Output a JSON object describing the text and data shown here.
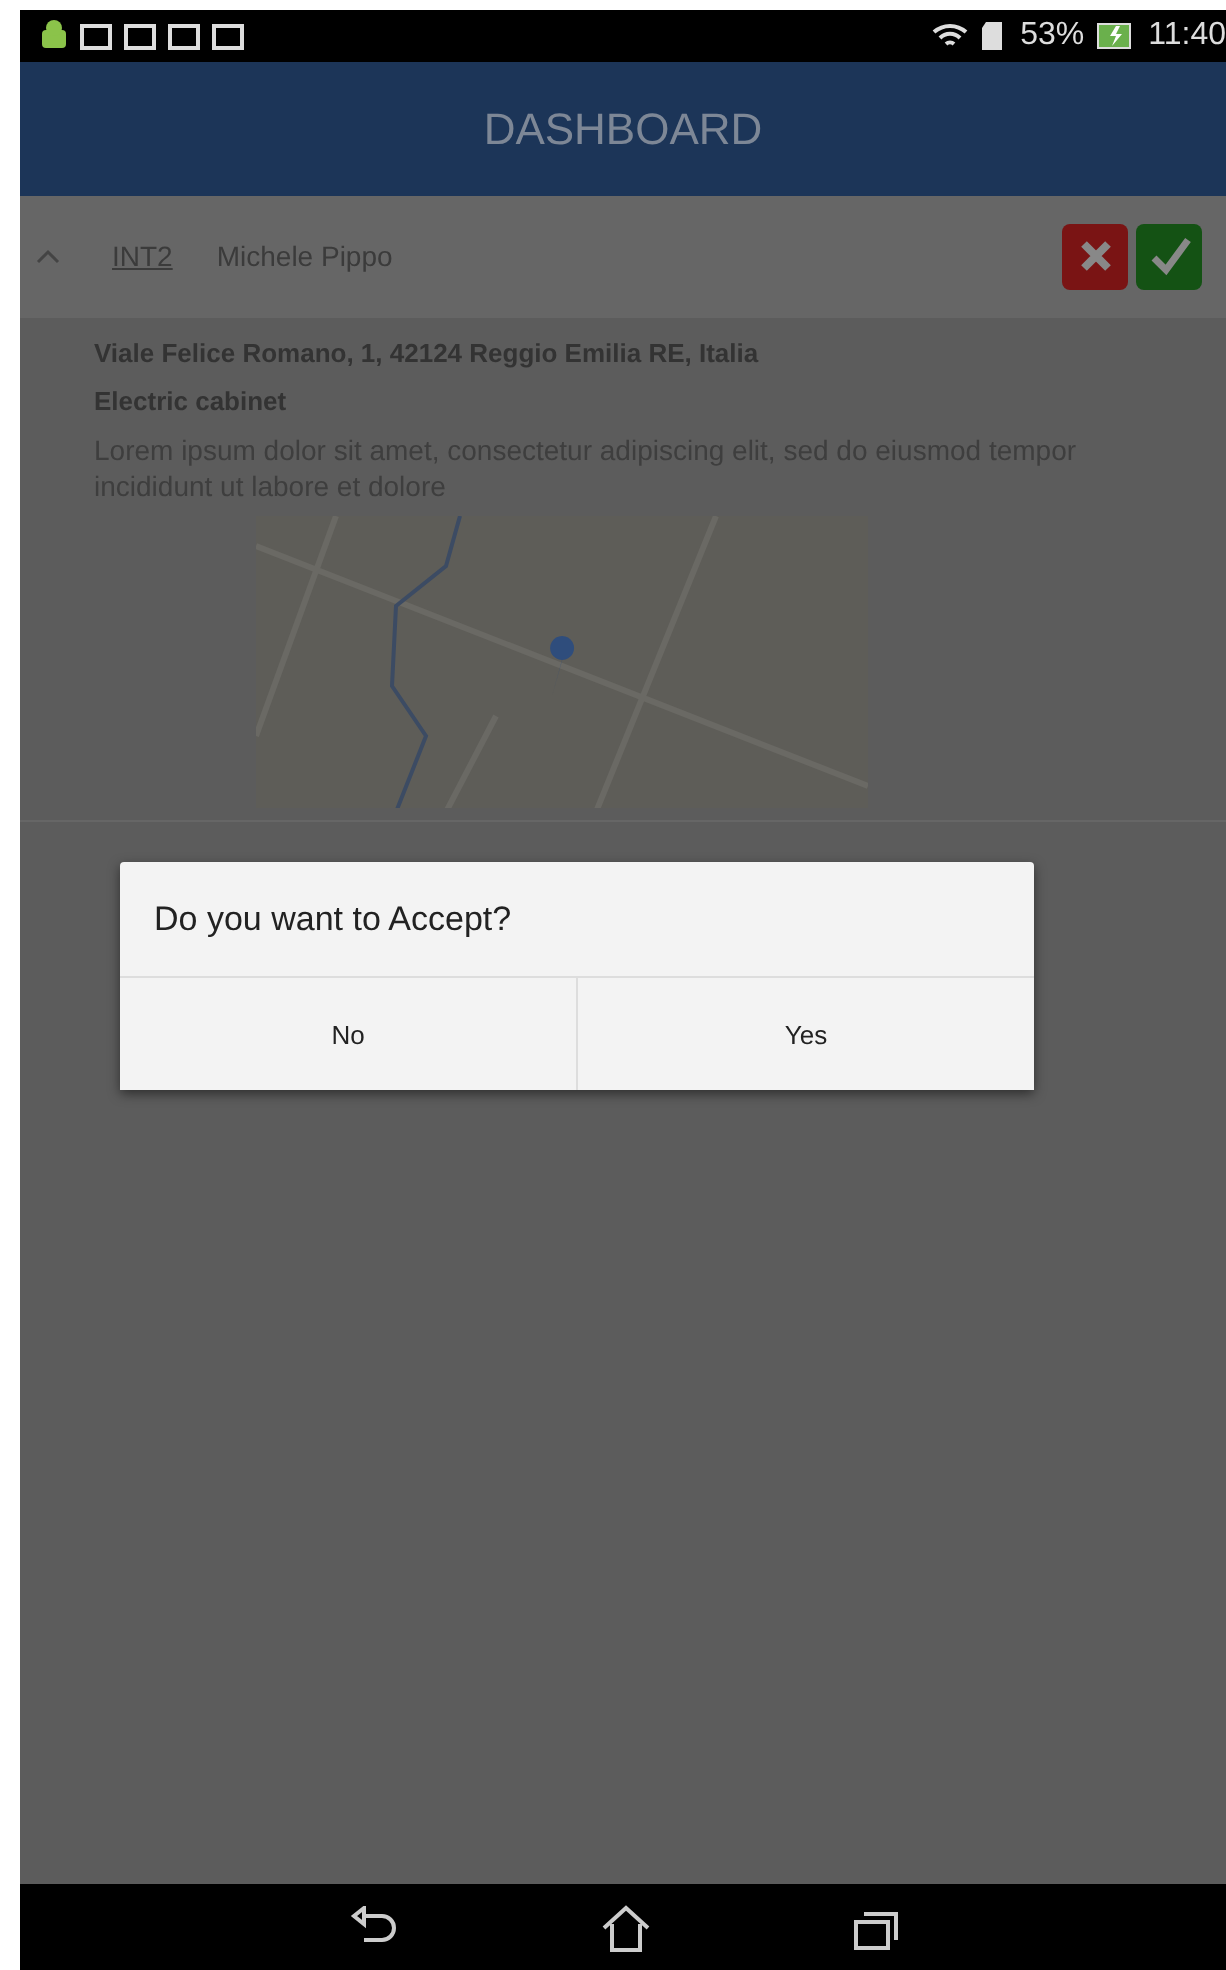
{
  "status_bar": {
    "battery": "53%",
    "time": "11:40"
  },
  "app_bar": {
    "title": "DASHBOARD"
  },
  "item": {
    "expanded": true,
    "code": "INT2",
    "name": "Michele Pippo",
    "address": "Viale Felice Romano, 1, 42124 Reggio Emilia RE, Italia",
    "category": "Electric cabinet",
    "description": "Lorem ipsum dolor sit amet, consectetur adipiscing elit, sed do eiusmod tempor incididunt ut labore et dolore"
  },
  "dialog": {
    "message": "Do you want to Accept?",
    "buttons": [
      {
        "label": "No"
      },
      {
        "label": "Yes"
      }
    ]
  }
}
